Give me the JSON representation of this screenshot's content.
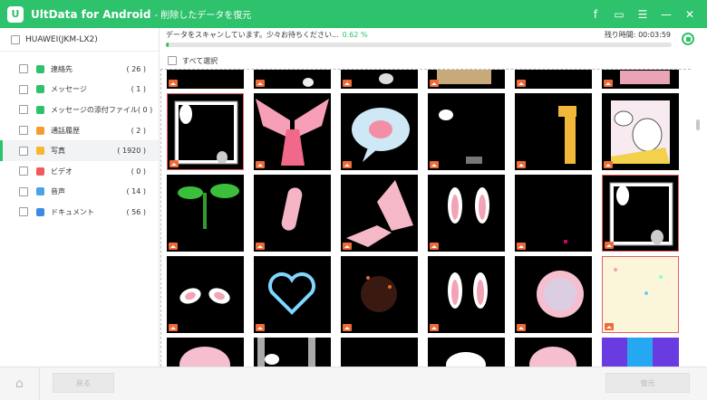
{
  "window": {
    "logo_letter": "U",
    "app_name": "UltData for Android",
    "subtitle": "- 削除したデータを復元",
    "icons": [
      "facebook-icon",
      "feedback-icon",
      "menu-icon",
      "minimize-icon",
      "close-icon"
    ],
    "icon_glyphs": {
      "facebook": "f",
      "feedback": "▭",
      "menu": "☰",
      "minimize": "—",
      "close": "✕"
    }
  },
  "sidebar": {
    "device": "HUAWEI(JKM-LX2)",
    "items": [
      {
        "label": "連絡先",
        "count": "( 26 )",
        "icon": "contacts-icon",
        "color": "#2dc26b"
      },
      {
        "label": "メッセージ",
        "count": "( 1 )",
        "icon": "messages-icon",
        "color": "#2dc26b"
      },
      {
        "label": "メッセージの添付ファイル",
        "count": "( 0 )",
        "icon": "attachment-icon",
        "color": "#2dc26b"
      },
      {
        "label": "通話履歴",
        "count": "( 2 )",
        "icon": "call-log-icon",
        "color": "#f39c34"
      },
      {
        "label": "写真",
        "count": "( 1920 )",
        "icon": "photos-icon",
        "color": "#f5b731"
      },
      {
        "label": "ビデオ",
        "count": "( 0 )",
        "icon": "video-icon",
        "color": "#ef5b5b"
      },
      {
        "label": "音声",
        "count": "( 14 )",
        "icon": "audio-icon",
        "color": "#4aa3e8"
      },
      {
        "label": "ドキュメント",
        "count": "( 56 )",
        "icon": "document-icon",
        "color": "#3d8be0"
      }
    ],
    "active_index": 4
  },
  "scan": {
    "status": "データをスキャンしています。少々お待ちください...",
    "percent_text": "0.62 %",
    "percent": 0.62,
    "remaining_label": "残り時間:",
    "remaining_time": "00:03:59"
  },
  "select_all": "すべて選択",
  "footer": {
    "back_label": "戻る",
    "recover_label": "復元"
  },
  "colors": {
    "accent": "#2dc26b",
    "badge": "#f06a38"
  }
}
